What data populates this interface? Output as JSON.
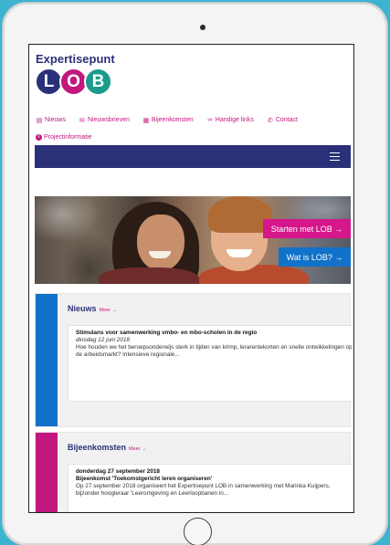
{
  "brand": {
    "name": "Expertisepunt",
    "logo_letters": [
      "L",
      "O",
      "B"
    ],
    "logo_colors": [
      "#2b3178",
      "#c2187e",
      "#1a9b8c"
    ]
  },
  "nav": {
    "row1": [
      {
        "icon": "newspaper-icon",
        "label": "Nieuws"
      },
      {
        "icon": "envelope-icon",
        "label": "Nieuwsbrieven"
      },
      {
        "icon": "calendar-icon",
        "label": "Bijeenkomsten"
      },
      {
        "icon": "link-icon",
        "label": "Handige links"
      },
      {
        "icon": "phone-icon",
        "label": "Contact"
      }
    ],
    "row2": [
      {
        "icon": "info-icon",
        "label": "Projectinformatie"
      }
    ]
  },
  "hero": {
    "buttons": {
      "start": "Starten met LOB →",
      "what": "Wat is LOB? →"
    }
  },
  "sections": {
    "news": {
      "title": "Nieuws",
      "more": "Meer →",
      "color": "#1272c9",
      "item": {
        "title": "Stimulans voor samenwerking vmbo- en mbo-scholen in de regio",
        "date": "dinsdag 12 juni 2018",
        "text": "Hoe houden we het beroepsonderwijs sterk in tijden van krimp, lerarentekorten en snelle ontwikkelingen op de arbeidsmarkt? Intensieve regionale..."
      }
    },
    "events": {
      "title": "Bijeenkomsten",
      "more": "Meer →",
      "color": "#c2187e",
      "item": {
        "date": "donderdag 27 september 2018",
        "title": "Bijeenkomst 'Toekomstgericht leren organiseren'",
        "text": "Op 27 september 2018 organiseert het Expertisepunt LOB in samenwerking met Marinka Kuijpers, bijzonder hoogleraar 'Leeromgeving en Leerloopbanen in..."
      }
    }
  },
  "colors": {
    "navy": "#2b3178",
    "magenta": "#c2187e",
    "blue": "#1272c9",
    "background": "#3bb3d1"
  }
}
